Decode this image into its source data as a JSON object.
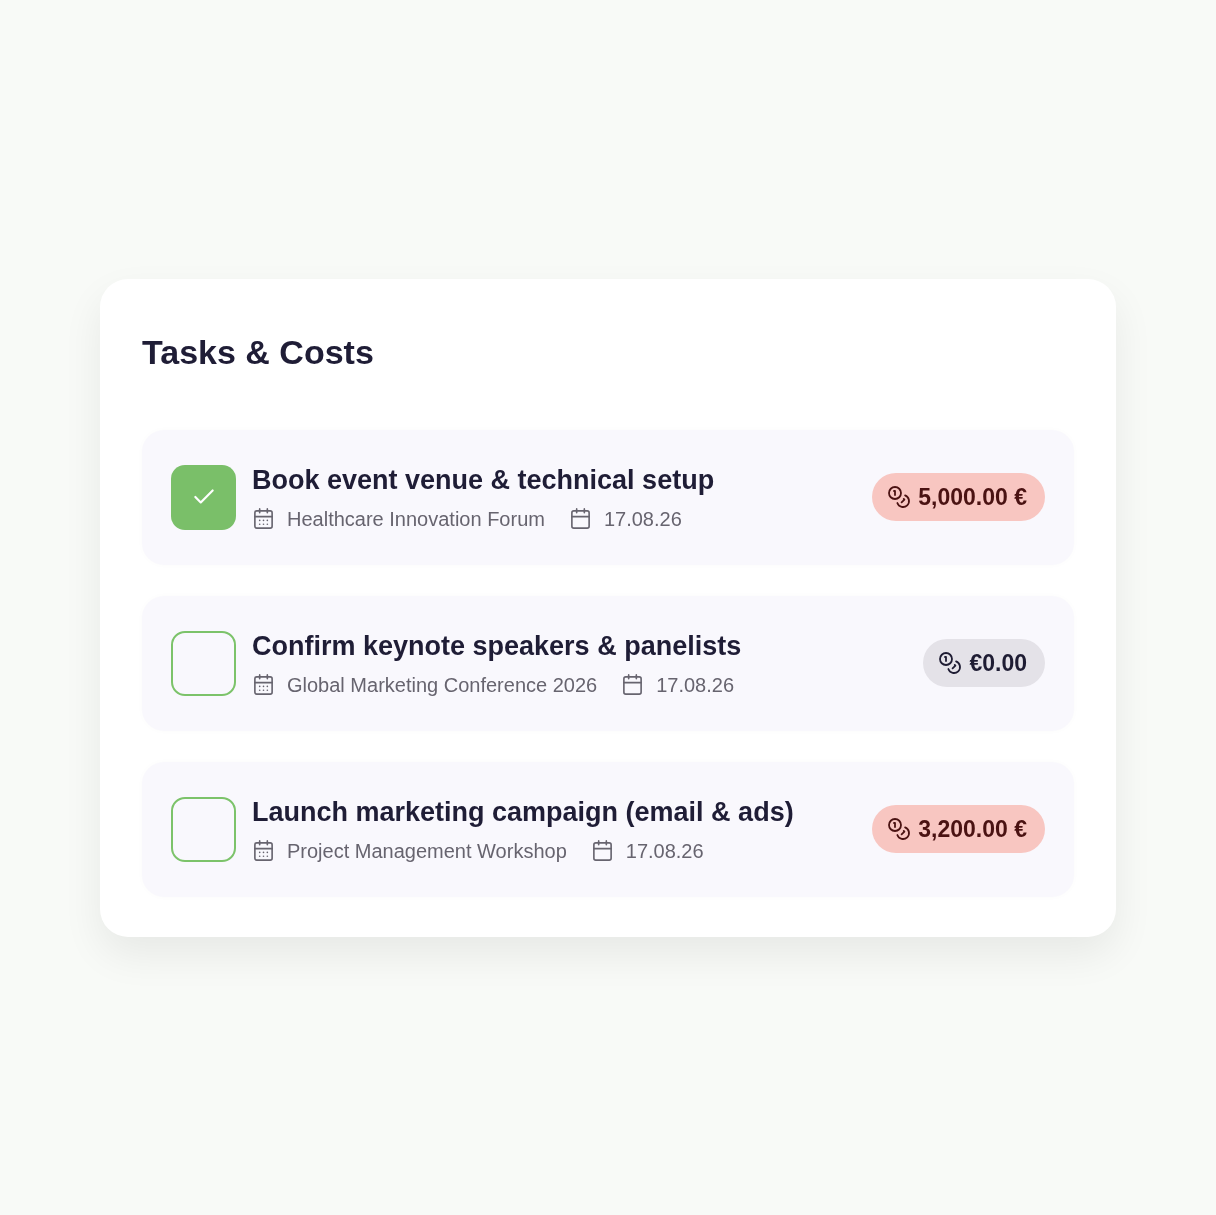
{
  "card": {
    "title": "Tasks & Costs"
  },
  "tasks": [
    {
      "title": "Book event venue & technical setup",
      "checked": true,
      "event": "Healthcare Innovation Forum",
      "date": "17.08.26",
      "cost": {
        "kind": "expense",
        "amount": "5,000.00 €"
      }
    },
    {
      "title": "Confirm keynote speakers & panelists",
      "checked": false,
      "event": "Global Marketing Conference 2026",
      "date": "17.08.26",
      "cost": {
        "kind": "zero",
        "amount": "€0.00"
      }
    },
    {
      "title": "Launch marketing campaign (email & ads)",
      "checked": false,
      "event": "Project Management Workshop",
      "date": "17.08.26",
      "cost": {
        "kind": "expense",
        "amount": "3,200.00 €"
      }
    }
  ]
}
